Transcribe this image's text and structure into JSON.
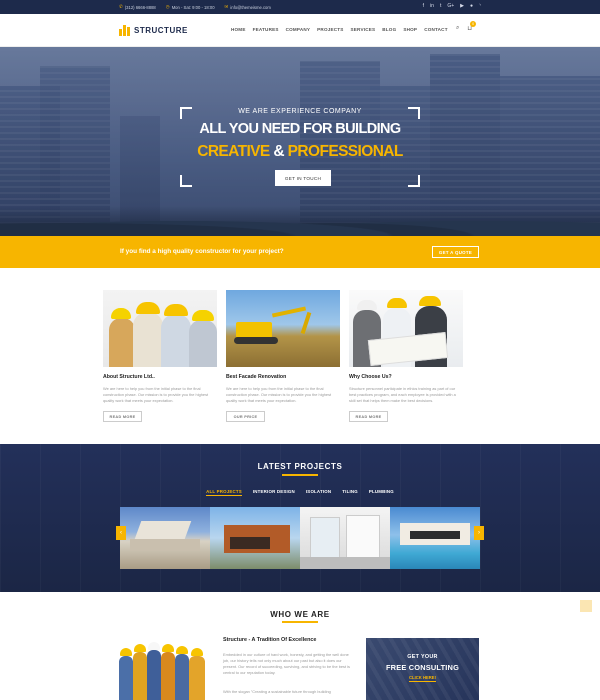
{
  "topbar": {
    "phone": "(312) 6666-8888",
    "hours": "Mon - Sat: 9:00 - 18:00",
    "email": "info@themeisme.com",
    "social": [
      "f",
      "in",
      "t",
      "G+",
      "yt",
      "fl",
      "rss"
    ]
  },
  "header": {
    "logo": "STRUCTURE",
    "nav": [
      "HOME",
      "FEATURES",
      "COMPANY",
      "PROJECTS",
      "SERVICES",
      "BLOG",
      "SHOP",
      "CONTACT"
    ],
    "cart_count": "0"
  },
  "hero": {
    "kicker": "WE ARE EXPERIENCE COMPANY",
    "title_line1": "ALL YOU NEED FOR BUILDING",
    "title_line2_part1": "CREATIVE",
    "title_line2_part2": " & ",
    "title_line2_part3": "PROFESSIONAL",
    "button": "GET IN TOUCH"
  },
  "cta": {
    "text": "If you find a high quality constructor for your project?",
    "button": "GET A QUOTE"
  },
  "features": [
    {
      "title": "About Structure Ltd..",
      "desc": "We are here to help you from the initial phase to the final construction phase. Our mission is to provide you the highest quality work that meets your expectation.",
      "button": "READ MORE"
    },
    {
      "title": "Best Facade Renovation",
      "desc": "We are here to help you from the initial phase to the final construction phase. Our mission is to provide you the highest quality work that meets your expectation.",
      "button": "OUR PRICE"
    },
    {
      "title": "Why Choose Us?",
      "desc": "Structure personnel participate in ethics training as part of our best practices program, and each employee is provided with a skill set that helps them make the best decisions.",
      "button": "READ MORE"
    }
  ],
  "projects": {
    "title": "LATEST PROJECTS",
    "filters": [
      "ALL PROJECTS",
      "INTERIOR DESIGN",
      "ISOLATION",
      "TILING",
      "PLUMBING"
    ],
    "prev": "‹",
    "next": "›"
  },
  "who": {
    "title": "WHO WE ARE",
    "about_title": "Structure - A Tradition Of Excellence",
    "p1": "Embedded in our culture of hard work, honesty, and getting the well done job, our history tells not only much about our past but also it does our present. Our record of succeeding, surviving, and striving to be the best is central to our reputation today.",
    "p2": "With the slogan \"Creating a sustainable future through building",
    "consult_l1": "GET YOUR",
    "consult_l2": "FREE CONSULTING",
    "consult_l3": "CLICK HERE!"
  },
  "colors": {
    "accent": "#f7b500",
    "navy": "#1d2a4b"
  }
}
